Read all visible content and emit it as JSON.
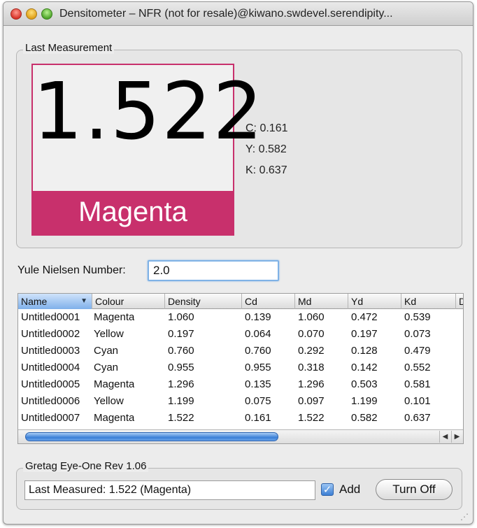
{
  "window": {
    "title": "Densitometer – NFR (not for resale)@kiwano.swdevel.serendipity..."
  },
  "last_measurement": {
    "group_label": "Last Measurement",
    "value": "1.522",
    "colour": "Magenta",
    "colour_hex": "#c8306c",
    "c": "C:  0.161",
    "y": "Y:  0.582",
    "k": "K:  0.637"
  },
  "yule_nielsen": {
    "label": "Yule Nielsen Number:",
    "value": "2.0"
  },
  "table": {
    "columns": [
      "Name",
      "Colour",
      "Density",
      "Cd",
      "Md",
      "Yd",
      "Kd",
      "D"
    ],
    "rows": [
      [
        "Untitled0001",
        "Magenta",
        "1.060",
        "0.139",
        "1.060",
        "0.472",
        "0.539"
      ],
      [
        "Untitled0002",
        "Yellow",
        "0.197",
        "0.064",
        "0.070",
        "0.197",
        "0.073"
      ],
      [
        "Untitled0003",
        "Cyan",
        "0.760",
        "0.760",
        "0.292",
        "0.128",
        "0.479"
      ],
      [
        "Untitled0004",
        "Cyan",
        "0.955",
        "0.955",
        "0.318",
        "0.142",
        "0.552"
      ],
      [
        "Untitled0005",
        "Magenta",
        "1.296",
        "0.135",
        "1.296",
        "0.503",
        "0.581"
      ],
      [
        "Untitled0006",
        "Yellow",
        "1.199",
        "0.075",
        "0.097",
        "1.199",
        "0.101"
      ],
      [
        "Untitled0007",
        "Magenta",
        "1.522",
        "0.161",
        "1.522",
        "0.582",
        "0.637"
      ]
    ]
  },
  "device": {
    "group_label": "Gretag Eye-One Rev 1.06",
    "status": "Last Measured: 1.522  (Magenta)",
    "add_label": "Add",
    "add_checked": true,
    "turn_off_label": "Turn Off"
  }
}
